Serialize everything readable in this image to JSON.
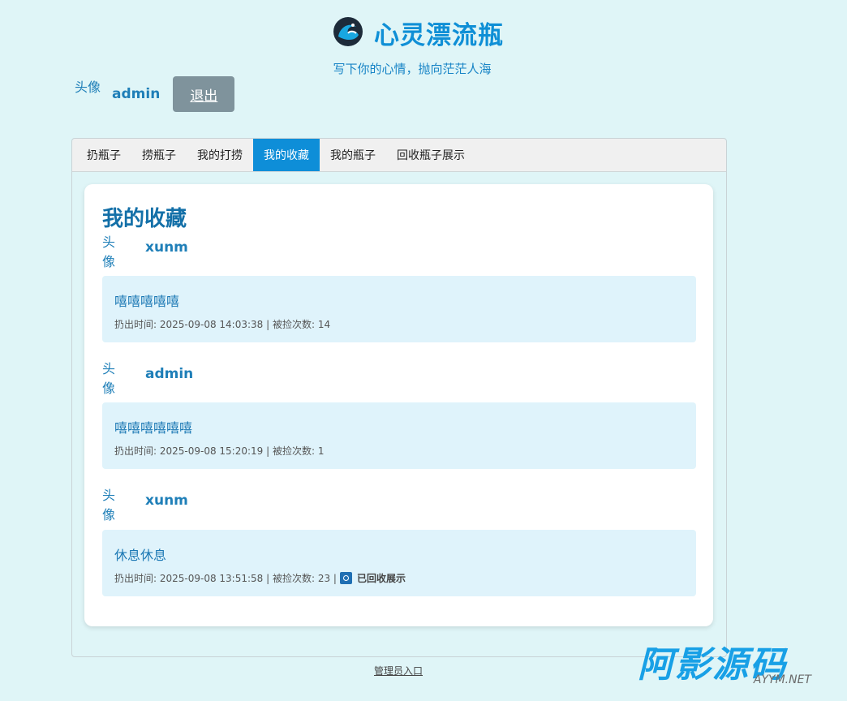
{
  "header": {
    "title": "心灵漂流瓶",
    "subtitle": "写下你的心情，抛向茫茫人海",
    "logo_icon": "wave-icon"
  },
  "user": {
    "avatar_alt": "头像",
    "name": "admin",
    "logout_label": "退出"
  },
  "tabs": [
    {
      "label": "扔瓶子",
      "active": false
    },
    {
      "label": "捞瓶子",
      "active": false
    },
    {
      "label": "我的打捞",
      "active": false
    },
    {
      "label": "我的收藏",
      "active": true
    },
    {
      "label": "我的瓶子",
      "active": false
    },
    {
      "label": "回收瓶子展示",
      "active": false
    }
  ],
  "main": {
    "title": "我的收藏",
    "entries": [
      {
        "avatar_alt": "头像",
        "user": "xunm",
        "content": "嘻嘻嘻嘻嘻",
        "meta": "扔出时间: 2025-09-08 14:03:38 | 被捡次数: 14"
      },
      {
        "avatar_alt": "头像",
        "user": "admin",
        "content": "嘻嘻嘻嘻嘻嘻",
        "meta": "扔出时间: 2025-09-08 15:20:19 | 被捡次数: 1"
      },
      {
        "avatar_alt": "头像",
        "user": "xunm",
        "content": "休息休息",
        "meta": "扔出时间: 2025-09-08 13:51:58 | 被捡次数: 23 |",
        "recycled_label": "已回收展示"
      }
    ]
  },
  "footer": {
    "admin_link": "管理员入口"
  },
  "watermark": {
    "cn": "阿影源码",
    "en": "AYYM.NET"
  },
  "colors": {
    "background": "#dff5f7",
    "accent": "#0e8ed8",
    "bottle_bg": "#dff3fb"
  }
}
